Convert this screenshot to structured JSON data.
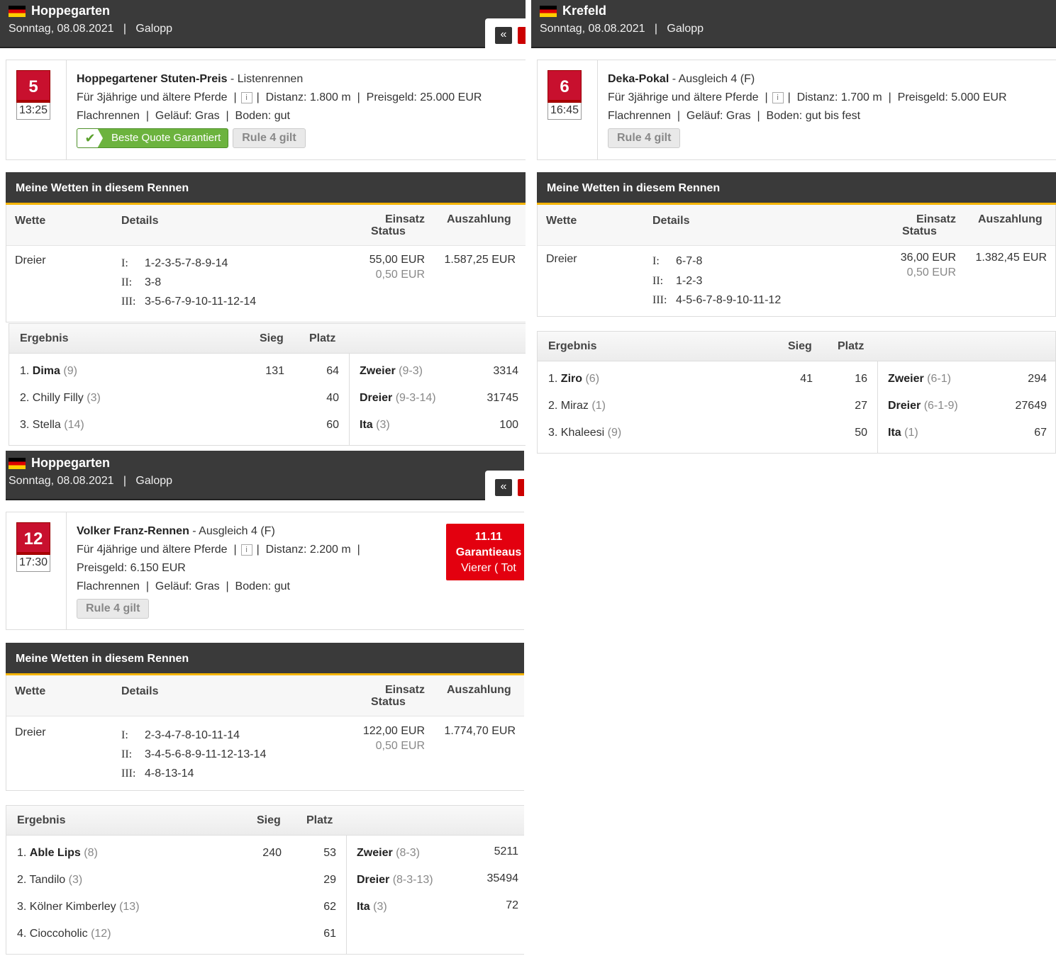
{
  "panels": [
    {
      "venue": "Hoppegarten",
      "date_line": "Sonntag, 08.08.2021",
      "sep": "|",
      "discipline": "Galopp",
      "prev_icon": "«",
      "race": {
        "number": "5",
        "time": "13:25",
        "title": "Hoppegartener Stuten-Preis",
        "category": " - Listenrennen",
        "age": "Für 3jährige und ältere Pferde",
        "distance": "Distanz: 1.800 m",
        "prize": "Preisgeld: 25.000 EUR",
        "type": "Flachrennen",
        "ground": "Geläuf: Gras",
        "going": "Boden: gut",
        "bqg_label": "Beste Quote Garantiert",
        "rule4": "Rule 4 gilt"
      },
      "bets": {
        "title": "Meine Wetten in diesem Rennen",
        "col_bet": "Wette",
        "col_details": "Details",
        "col_stake": "Einsatz",
        "col_status": "Status",
        "col_payout": "Auszahlung",
        "bet_type": "Dreier",
        "legs": [
          {
            "k": "I:",
            "v": "1-2-3-5-7-8-9-14"
          },
          {
            "k": "II:",
            "v": "3-8"
          },
          {
            "k": "III:",
            "v": "3-5-6-7-9-10-11-12-14"
          }
        ],
        "stake": "55,00 EUR",
        "status": "0,50 EUR",
        "payout": "1.587,25 EUR"
      },
      "result": {
        "col_result": "Ergebnis",
        "col_win": "Sieg",
        "col_place": "Platz",
        "runners": [
          {
            "pos": "1.",
            "name": "Dima",
            "no": "(9)",
            "win": "131",
            "place": "64"
          },
          {
            "pos": "2.",
            "name": "Chilly Filly",
            "no": "(3)",
            "win": "",
            "place": "40"
          },
          {
            "pos": "3.",
            "name": "Stella",
            "no": "(14)",
            "win": "",
            "place": "60"
          }
        ],
        "exotics": [
          {
            "name": "Zweier",
            "combo": "(9-3)",
            "value": "3314"
          },
          {
            "name": "Dreier",
            "combo": "(9-3-14)",
            "value": "31745"
          },
          {
            "name": "Ita",
            "combo": "(3)",
            "value": "100"
          }
        ]
      }
    },
    {
      "venue": "Krefeld",
      "date_line": "Sonntag, 08.08.2021",
      "sep": "|",
      "discipline": "Galopp",
      "race": {
        "number": "6",
        "time": "16:45",
        "title": "Deka-Pokal",
        "category": " - Ausgleich 4 (F)",
        "age": "Für 3jährige und ältere Pferde",
        "distance": "Distanz: 1.700 m",
        "prize": "Preisgeld: 5.000 EUR",
        "type": "Flachrennen",
        "ground": "Geläuf: Gras",
        "going": "Boden: gut bis fest",
        "rule4": "Rule 4 gilt"
      },
      "bets": {
        "title": "Meine Wetten in diesem Rennen",
        "col_bet": "Wette",
        "col_details": "Details",
        "col_stake": "Einsatz",
        "col_status": "Status",
        "col_payout": "Auszahlung",
        "bet_type": "Dreier",
        "legs": [
          {
            "k": "I:",
            "v": "6-7-8"
          },
          {
            "k": "II:",
            "v": "1-2-3"
          },
          {
            "k": "III:",
            "v": "4-5-6-7-8-9-10-11-12"
          }
        ],
        "stake": "36,00 EUR",
        "status": "0,50 EUR",
        "payout": "1.382,45 EUR"
      },
      "result": {
        "col_result": "Ergebnis",
        "col_win": "Sieg",
        "col_place": "Platz",
        "runners": [
          {
            "pos": "1.",
            "name": "Ziro",
            "no": "(6)",
            "win": "41",
            "place": "16"
          },
          {
            "pos": "2.",
            "name": "Miraz",
            "no": "(1)",
            "win": "",
            "place": "27"
          },
          {
            "pos": "3.",
            "name": "Khaleesi",
            "no": "(9)",
            "win": "",
            "place": "50"
          }
        ],
        "exotics": [
          {
            "name": "Zweier",
            "combo": "(6-1)",
            "value": "294"
          },
          {
            "name": "Dreier",
            "combo": "(6-1-9)",
            "value": "27649"
          },
          {
            "name": "Ita",
            "combo": "(1)",
            "value": "67"
          }
        ]
      }
    },
    {
      "venue": "Hoppegarten",
      "date_line": "Sonntag, 08.08.2021",
      "sep": "|",
      "discipline": "Galopp",
      "prev_icon": "«",
      "race": {
        "number": "12",
        "time": "17:30",
        "title": "Volker Franz-Rennen",
        "category": " - Ausgleich 4 (F)",
        "age": "Für 4jährige und ältere Pferde",
        "distance": "Distanz: 2.200 m",
        "prize": "Preisgeld: 6.150 EUR",
        "type": "Flachrennen",
        "ground": "Geläuf: Gras",
        "going": "Boden: gut",
        "rule4": "Rule 4 gilt",
        "guarantee_1": "11.11",
        "guarantee_2": "Garantieaus",
        "guarantee_3": "Vierer ( Tot"
      },
      "bets": {
        "title": "Meine Wetten in diesem Rennen",
        "col_bet": "Wette",
        "col_details": "Details",
        "col_stake": "Einsatz",
        "col_status": "Status",
        "col_payout": "Auszahlung",
        "bet_type": "Dreier",
        "legs": [
          {
            "k": "I:",
            "v": "2-3-4-7-8-10-11-14"
          },
          {
            "k": "II:",
            "v": "3-4-5-6-8-9-11-12-13-14"
          },
          {
            "k": "III:",
            "v": "4-8-13-14"
          }
        ],
        "stake": "122,00 EUR",
        "status": "0,50 EUR",
        "payout": "1.774,70 EUR"
      },
      "result": {
        "col_result": "Ergebnis",
        "col_win": "Sieg",
        "col_place": "Platz",
        "runners": [
          {
            "pos": "1.",
            "name": "Able Lips",
            "no": "(8)",
            "win": "240",
            "place": "53"
          },
          {
            "pos": "2.",
            "name": "Tandilo",
            "no": "(3)",
            "win": "",
            "place": "29"
          },
          {
            "pos": "3.",
            "name": "Kölner Kimberley",
            "no": "(13)",
            "win": "",
            "place": "62"
          },
          {
            "pos": "4.",
            "name": "Cioccoholic",
            "no": "(12)",
            "win": "",
            "place": "61"
          }
        ],
        "exotics": [
          {
            "name": "Zweier",
            "combo": "(8-3)",
            "value": "5211"
          },
          {
            "name": "Dreier",
            "combo": "(8-3-13)",
            "value": "35494"
          },
          {
            "name": "Ita",
            "combo": "(3)",
            "value": "72"
          }
        ]
      }
    }
  ]
}
